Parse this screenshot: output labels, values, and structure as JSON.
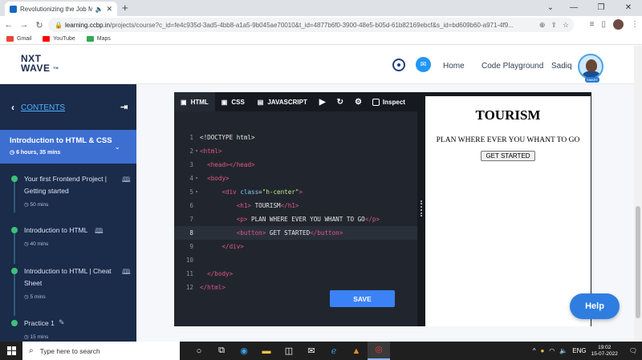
{
  "browser": {
    "tab_title": "Revolutionizing the Job Mar",
    "tab_speaker": "🔈",
    "tab_close": "✕",
    "new_tab": "+",
    "url_host": "learning.ccbp.in",
    "url_path": "/projects/course?c_id=fe4c935d-3ad5-4bb8-a1a5-9b045ae70010&t_id=4877b6f0-3900-48e5-b05d-61b82169ebcf&s_id=bd609b60-a971-4f9...",
    "bookmarks": [
      "Gmail",
      "YouTube",
      "Maps"
    ],
    "colors": {
      "gmail": "#ea4335",
      "youtube": "#ff0000",
      "maps": "#34a853"
    }
  },
  "header": {
    "logo_line1": "NXT",
    "logo_line2": "WAVE",
    "logo_tm": "TM",
    "nav": [
      "Home",
      "Code Playground",
      "Sadiq"
    ],
    "badge": "SMART"
  },
  "sidebar": {
    "contents_label": "CONTENTS",
    "active_course": {
      "title": "Introduction to HTML & CSS",
      "duration": "6 hours, 35 mins"
    },
    "lessons": [
      {
        "title": "Your first Frontend Project | Getting started",
        "duration": "50 mins",
        "icon": "book-icon"
      },
      {
        "title": "Introduction to HTML",
        "duration": "40 mins",
        "icon": "book-icon"
      },
      {
        "title": "Introduction to HTML | Cheat Sheet",
        "duration": "5 mins",
        "icon": "book-icon"
      },
      {
        "title": "Practice 1",
        "duration": "15 mins",
        "icon": "pencil-icon"
      }
    ]
  },
  "editor": {
    "tabs": [
      "HTML",
      "CSS",
      "JAVASCRIPT"
    ],
    "inspect_label": "Inspect",
    "save_label": "SAVE",
    "line_numbers": [
      "1",
      "2",
      "3",
      "4",
      "5",
      "6",
      "7",
      "8",
      "9",
      "10",
      "11",
      "12"
    ]
  },
  "preview": {
    "heading": "TOURISM",
    "paragraph": "PLAN WHERE EVER YOU WHANT TO GO",
    "button": "GET STARTED"
  },
  "help_label": "Help",
  "taskbar": {
    "search_placeholder": "Type here to search",
    "time": "19:02",
    "date": "15-07-2022",
    "lang": "ENG"
  }
}
